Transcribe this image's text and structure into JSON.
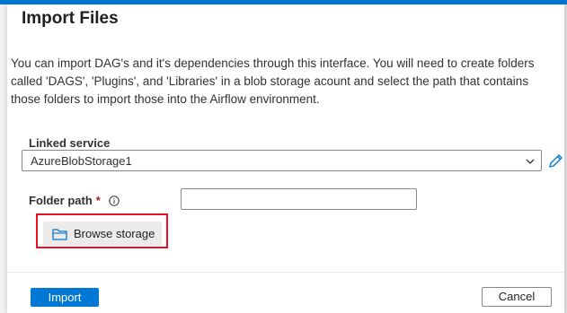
{
  "dialog": {
    "title": "Import Files",
    "description": "You can import DAG's and it's dependencies through this interface. You will need to create folders called 'DAGS', 'Plugins', and 'Libraries' in a blob storage acount and select the path that contains those folders to import those into the Airflow environment."
  },
  "linked_service": {
    "label": "Linked service",
    "value": "AzureBlobStorage1"
  },
  "folder_path": {
    "label": "Folder path",
    "required_mark": "*",
    "value": ""
  },
  "browse": {
    "label": "Browse storage"
  },
  "footer": {
    "import_label": "Import",
    "cancel_label": "Cancel"
  },
  "icons": {
    "info": "info-icon",
    "chevron": "chevron-down-icon",
    "edit": "pencil-icon",
    "folder": "folder-icon"
  },
  "colors": {
    "accent": "#0078d4",
    "highlight": "#e81123",
    "required": "#a4262c"
  }
}
